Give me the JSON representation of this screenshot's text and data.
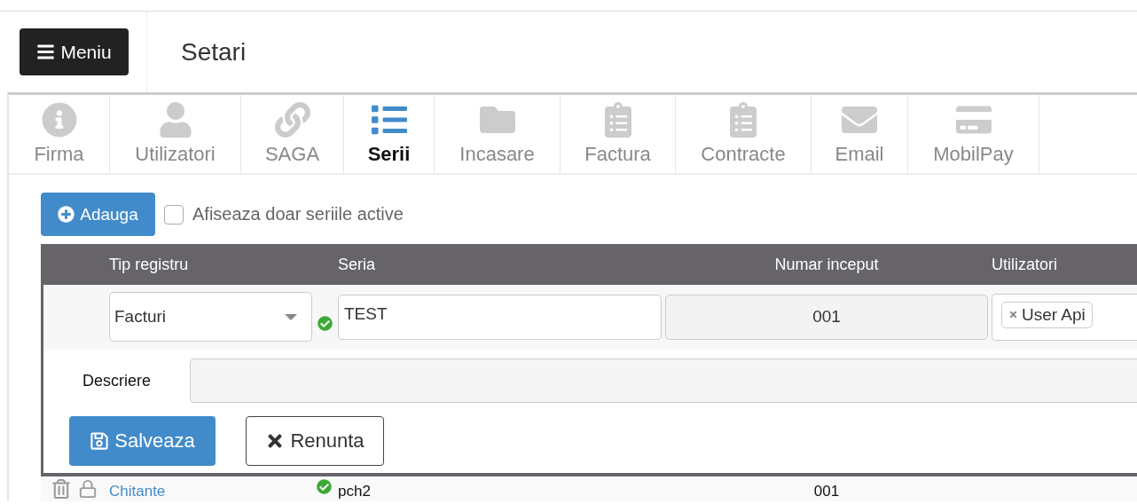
{
  "header": {
    "menu_button": "Meniu",
    "title": "Setari"
  },
  "tabs": [
    {
      "label": "Firma",
      "selected": false
    },
    {
      "label": "Utilizatori",
      "selected": false
    },
    {
      "label": "SAGA",
      "selected": false
    },
    {
      "label": "Serii",
      "selected": true
    },
    {
      "label": "Incasare",
      "selected": false
    },
    {
      "label": "Factura",
      "selected": false
    },
    {
      "label": "Contracte",
      "selected": false
    },
    {
      "label": "Email",
      "selected": false
    },
    {
      "label": "MobilPay",
      "selected": false
    }
  ],
  "toolbar": {
    "add_button": "Adauga",
    "filter": {
      "label": "Afiseaza doar seriile active",
      "checked": false
    }
  },
  "table": {
    "columns": [
      "Tip registru",
      "Seria",
      "Numar inceput",
      "Utilizatori"
    ],
    "edit_row": {
      "register_type": "Facturi",
      "series": "TEST",
      "series_valid": true,
      "start_number": "001",
      "users": [
        "User Api"
      ],
      "description_label": "Descriere",
      "save_button": "Salveaza",
      "cancel_button": "Renunta"
    },
    "rows": [
      {
        "register_type": "Chitante",
        "series": "pch2",
        "active": true,
        "start_number": "001"
      }
    ]
  }
}
